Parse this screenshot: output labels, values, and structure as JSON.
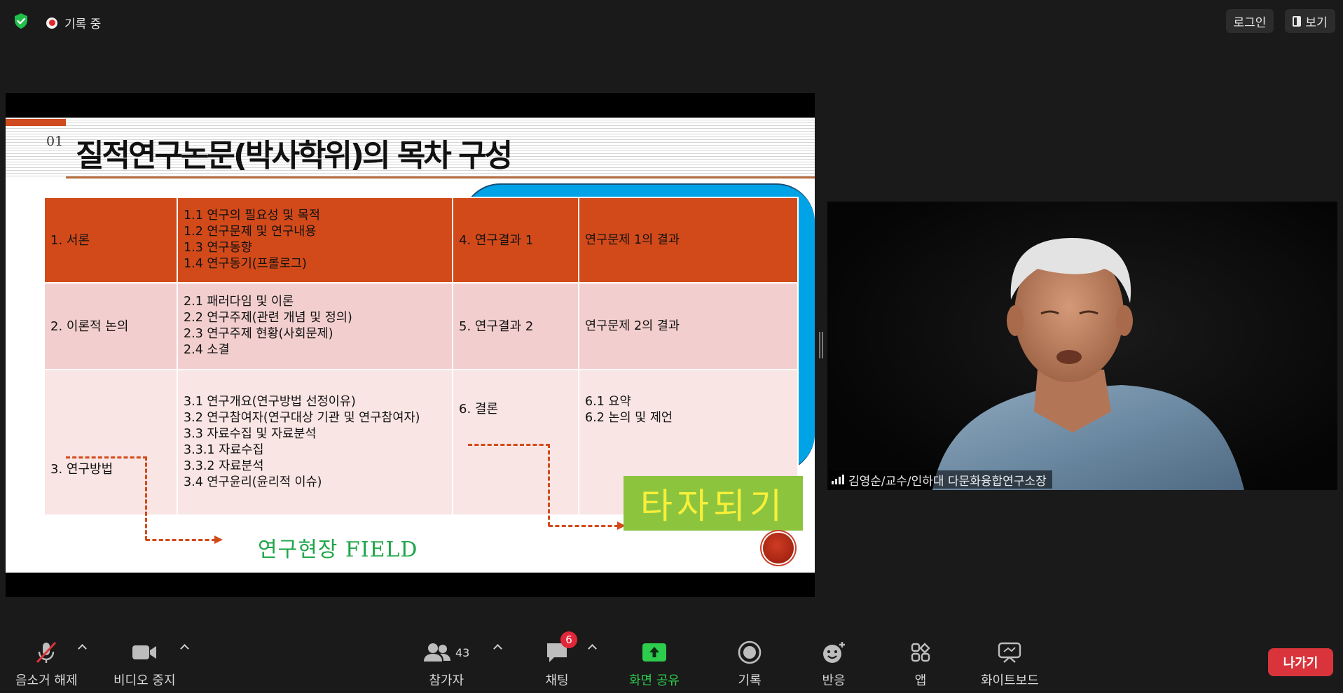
{
  "top": {
    "recording_label": "기록 중",
    "login_label": "로그인",
    "view_label": "보기"
  },
  "slide": {
    "number": "01",
    "title": "질적연구논문(박사학위)의 목차 구성",
    "rows": [
      {
        "left_heading": "1. 서론",
        "left_items": [
          "1.1 연구의 필요성 및 목적",
          "1.2 연구문제 및 연구내용",
          "1.3 연구동향",
          "1.4 연구동기(프롤로그)"
        ],
        "right_heading": "4. 연구결과 1",
        "right_items": [
          "연구문제 1의 결과"
        ]
      },
      {
        "left_heading": "2. 이론적 논의",
        "left_items": [
          "2.1 패러다임 및 이론",
          "2.2 연구주제(관련 개념 및 정의)",
          "2.3 연구주제 현황(사회문제)",
          "2.4 소결"
        ],
        "right_heading": "5. 연구결과 2",
        "right_items": [
          "연구문제 2의 결과"
        ]
      },
      {
        "left_heading": "3. 연구방법",
        "left_items": [
          "3.1 연구개요(연구방법 선정이유)",
          "3.2 연구참여자(연구대상 기관 및 연구참여자)",
          "3.3 자료수집 및 자료분석",
          "3.3.1 자료수집",
          "3.3.2 자료분석",
          "3.4 연구윤리(윤리적 이슈)"
        ],
        "right_heading": "6. 결론",
        "right_items": [
          "6.1 요약",
          "6.2 논의 및 제언"
        ]
      }
    ],
    "field_label": "연구현장  FIELD",
    "other_label": "타자되기"
  },
  "video": {
    "participant_name": "김영순/교수/인하대 다문화융합연구소장"
  },
  "toolbar": {
    "mute_label": "음소거 해제",
    "video_label": "비디오 중지",
    "participants_label": "참가자",
    "participants_count": "43",
    "chat_label": "채팅",
    "chat_badge": "6",
    "share_label": "화면 공유",
    "record_label": "기록",
    "reactions_label": "반응",
    "apps_label": "앱",
    "whiteboard_label": "화이트보드",
    "leave_label": "나가기"
  },
  "colors": {
    "slide_orange": "#d24a1a",
    "slide_pink": "#f2cfce",
    "slide_light_pink": "#f9e5e4",
    "slide_blue": "#00a3e6",
    "share_green": "#2ecc4d",
    "leave_red": "#d9333b"
  }
}
